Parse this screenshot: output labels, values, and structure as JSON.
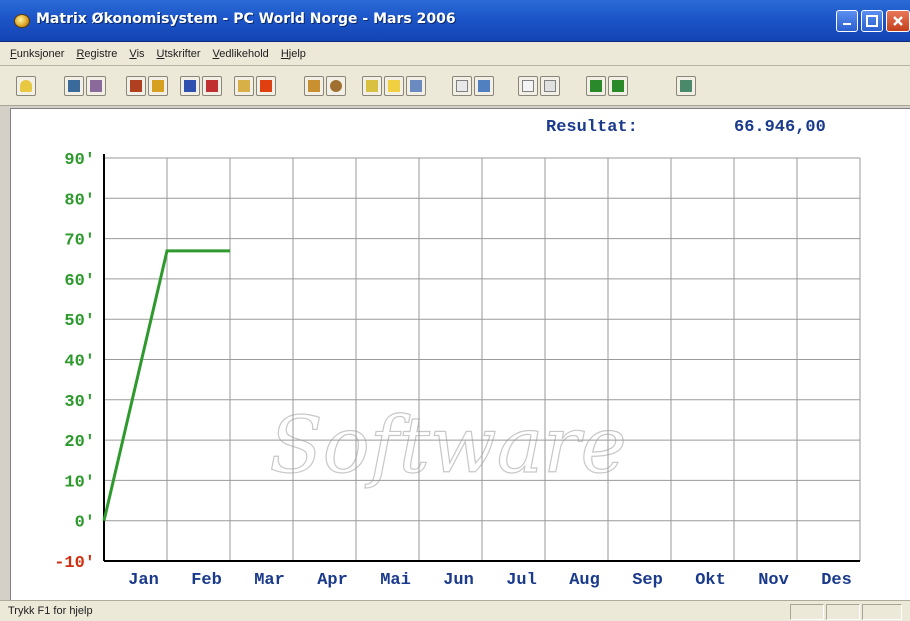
{
  "window": {
    "title": "Matrix Økonomisystem - PC World Norge - Mars 2006",
    "minimize_icon": "minimize-icon",
    "maximize_icon": "maximize-icon",
    "close_icon": "close-icon"
  },
  "menu": {
    "items": [
      "Funksjoner",
      "Registre",
      "Vis",
      "Utskrifter",
      "Vedlikehold",
      "Hjelp"
    ]
  },
  "toolbar": {
    "icons": [
      "key-icon",
      "monitor-icon",
      "book-icon",
      "house-icon",
      "cabinet-icon",
      "chart-icon",
      "chart-red-icon",
      "folder-icon",
      "alert-icon",
      "scale-icon",
      "globe-icon",
      "question-icon",
      "envelope-icon",
      "graph-icon",
      "window-icon",
      "people-icon",
      "document-icon",
      "copy-icon",
      "green-doc-icon",
      "green-copy-icon",
      "export-icon"
    ]
  },
  "result": {
    "label": "Resultat:",
    "value": "66.946,00"
  },
  "watermark": "Software",
  "status": {
    "text": "Trykk F1 for hjelp"
  },
  "colors": {
    "accent": "#2e9a2e",
    "negative": "#d03010",
    "axis_text": "#1a3a8c",
    "grid": "#9a9a9a"
  },
  "chart_data": {
    "type": "line",
    "categories": [
      "Jan",
      "Feb",
      "Mar",
      "Apr",
      "Mai",
      "Jun",
      "Jul",
      "Aug",
      "Sep",
      "Okt",
      "Nov",
      "Des"
    ],
    "ytick_labels": [
      "90'",
      "80'",
      "70'",
      "60'",
      "50'",
      "40'",
      "30'",
      "20'",
      "10'",
      "0'",
      "-10'"
    ],
    "ytick_values": [
      90,
      80,
      70,
      60,
      50,
      40,
      30,
      20,
      10,
      0,
      -10
    ],
    "ylim": [
      -10,
      90
    ],
    "grid": true,
    "series": [
      {
        "x": [
          0,
          1,
          2
        ],
        "values": [
          0,
          66.946,
          66.946
        ]
      }
    ]
  }
}
